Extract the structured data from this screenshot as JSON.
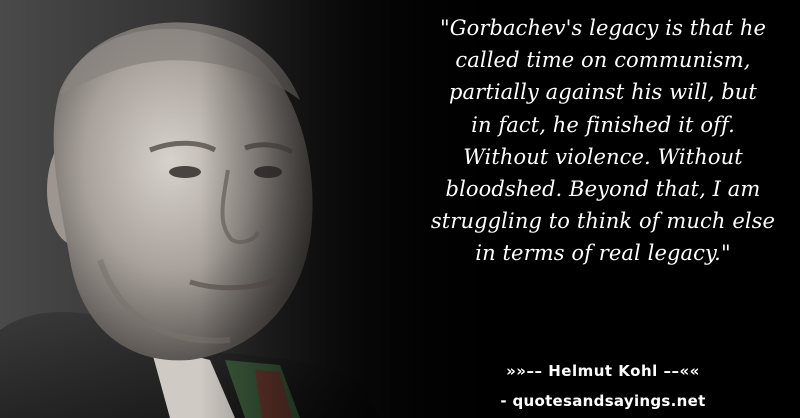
{
  "quote": {
    "lines": [
      "\"Gorbachev's legacy is that he",
      "called time on communism,",
      "partially against his will, but",
      "in fact, he finished it off.",
      "Without violence. Without",
      "bloodshed. Beyond that, I am",
      "struggling to think of much else",
      "in terms of real legacy.\""
    ]
  },
  "author": {
    "text": "»»–– Helmut Kohl ––««"
  },
  "site": {
    "text": "- quotesandsayings.net"
  },
  "colors": {
    "background": "#000000",
    "text": "#ffffff"
  }
}
